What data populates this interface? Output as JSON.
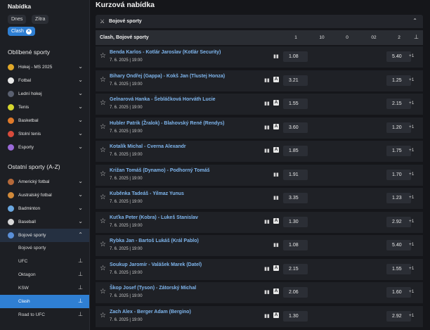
{
  "sidebar": {
    "title": "Nabídka",
    "chips": {
      "today": "Dnes",
      "tomorrow": "Zítra",
      "filter": "Clash"
    },
    "favorites_heading": "Oblíbené sporty",
    "favorites": [
      {
        "label": "Hokej - MS 2025",
        "color": "#e0a829"
      },
      {
        "label": "Fotbal",
        "color": "#e8e8e8"
      },
      {
        "label": "Lední hokej",
        "color": "#5a6070"
      },
      {
        "label": "Tenis",
        "color": "#d6d62e"
      },
      {
        "label": "Basketbal",
        "color": "#e07a2a"
      },
      {
        "label": "Stolní tenis",
        "color": "#d84b3c"
      },
      {
        "label": "Esporty",
        "color": "#9a6ad8"
      }
    ],
    "other_heading": "Ostatní sporty (A-Z)",
    "others": [
      {
        "label": "Americký fotbal",
        "color": "#b5693a"
      },
      {
        "label": "Australský fotbal",
        "color": "#d18a3a"
      },
      {
        "label": "Badminton",
        "color": "#6aa7e0"
      },
      {
        "label": "Baseball",
        "color": "#d8d8d8"
      },
      {
        "label": "Bojové sporty",
        "color": "#5a8fd8"
      }
    ],
    "sub": [
      "Bojové sporty",
      "UFC",
      "Oktagon",
      "KSW",
      "Clash",
      "Road to UFC"
    ]
  },
  "main": {
    "title": "Kurzová nabídka",
    "sport_label": "Bojové sporty",
    "table_label": "Clash, Bojové sporty",
    "columns": [
      "1",
      "10",
      "0",
      "02",
      "2"
    ],
    "more_prefix": "+1"
  },
  "matches": [
    {
      "name": "Benda Karlos - Kotlár Jaroslav (Kotlár Security)",
      "date": "7. 6. 2025 | 19:00",
      "odd1": "1.08",
      "odd2": "5.40",
      "badge": false
    },
    {
      "name": "Bihary Ondřej (Gappa) - Kokš Jan (Tlustej Honza)",
      "date": "7. 6. 2025 | 19:00",
      "odd1": "3.21",
      "odd2": "1.25",
      "badge": true
    },
    {
      "name": "Gelnarová Hanka - Šebláčková Horváth Lucie",
      "date": "7. 6. 2025 | 19:00",
      "odd1": "1.55",
      "odd2": "2.15",
      "badge": true
    },
    {
      "name": "Hubler Patrik (Žralok) - Blahovský René (Rendys)",
      "date": "7. 6. 2025 | 19:00",
      "odd1": "3.60",
      "odd2": "1.20",
      "badge": true
    },
    {
      "name": "Kotalík Michal - Cverna Alexandr",
      "date": "7. 6. 2025 | 19:00",
      "odd1": "1.85",
      "odd2": "1.75",
      "badge": true
    },
    {
      "name": "Križan Tomáš (Dynamo) - Podhorný Tomáš",
      "date": "7. 6. 2025 | 19:00",
      "odd1": "1.91",
      "odd2": "1.70",
      "badge": false
    },
    {
      "name": "Kuběnka Tadeáš - Yilmaz Yunus",
      "date": "7. 6. 2025 | 19:00",
      "odd1": "3.35",
      "odd2": "1.23",
      "badge": false
    },
    {
      "name": "Kuťka Peter (Kobra) - Lukeš Stanislav",
      "date": "7. 6. 2025 | 19:00",
      "odd1": "1.30",
      "odd2": "2.92",
      "badge": true
    },
    {
      "name": "Rybka Jan - Bartoš Lukáš (Král Pablo)",
      "date": "7. 6. 2025 | 19:00",
      "odd1": "1.08",
      "odd2": "5.40",
      "badge": false
    },
    {
      "name": "Soukup Jaromír - Valášek Marek (Datel)",
      "date": "7. 6. 2025 | 19:00",
      "odd1": "2.15",
      "odd2": "1.55",
      "badge": true
    },
    {
      "name": "Škop Josef (Tyson) - Zátorský Michal",
      "date": "7. 6. 2025 | 19:00",
      "odd1": "2.06",
      "odd2": "1.60",
      "badge": true
    },
    {
      "name": "Zach Alex - Berger Adam (Bergino)",
      "date": "7. 6. 2025 | 19:00",
      "odd1": "1.30",
      "odd2": "2.92",
      "badge": true
    }
  ]
}
